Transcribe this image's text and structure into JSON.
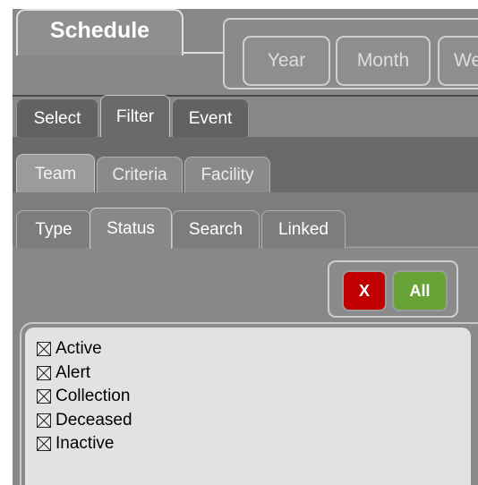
{
  "schedule": {
    "title": "Schedule"
  },
  "period_buttons": [
    "Year",
    "Month",
    "Wee"
  ],
  "mode_tabs": [
    "Select",
    "Filter",
    "Event"
  ],
  "group_tabs": [
    "Team",
    "Criteria",
    "Facility"
  ],
  "filter_tabs": [
    "Type",
    "Status",
    "Search",
    "Linked"
  ],
  "actions": {
    "clear_label": "X",
    "all_label": "All"
  },
  "statuses": [
    {
      "label": "Active",
      "checked": true
    },
    {
      "label": "Alert",
      "checked": true
    },
    {
      "label": "Collection",
      "checked": true
    },
    {
      "label": "Deceased",
      "checked": true
    },
    {
      "label": "Inactive",
      "checked": true
    }
  ],
  "colors": {
    "clear_button": "#c00000",
    "all_button": "#67a336",
    "list_background": "#e2e2e2"
  }
}
